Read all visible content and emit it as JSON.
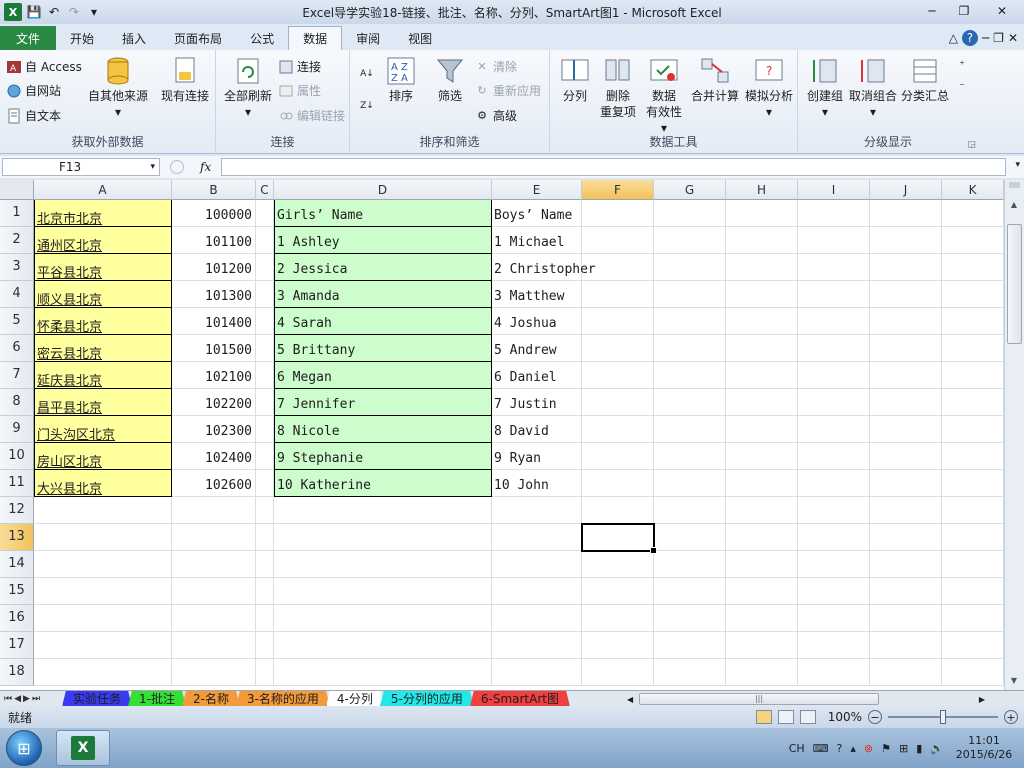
{
  "window": {
    "title": "Excel导学实验18-链接、批注、名称、分列、SmartArt图1 - Microsoft Excel",
    "minimize": "─",
    "maximize": "❐",
    "close": "✕"
  },
  "qat": {
    "save": "💾",
    "undo": "↶",
    "redo": "↷",
    "more": "▾"
  },
  "tabs": [
    "文件",
    "开始",
    "插入",
    "页面布局",
    "公式",
    "数据",
    "审阅",
    "视图"
  ],
  "tab_right": {
    "collapse": "△",
    "help": "?",
    "min": "─",
    "restore": "❐",
    "close": "✕"
  },
  "ribbon": {
    "ext": {
      "label": "获取外部数据",
      "access": "自 Access",
      "web": "自网站",
      "text": "自文本",
      "other": "自其他来源",
      "existing": "现有连接"
    },
    "conn": {
      "label": "连接",
      "refresh": "全部刷新",
      "connections": "连接",
      "properties": "属性",
      "edit_links": "编辑链接"
    },
    "sort": {
      "label": "排序和筛选",
      "az": "A↓Z",
      "za": "Z↓A",
      "sort": "排序",
      "filter": "筛选",
      "clear": "清除",
      "reapply": "重新应用",
      "advanced": "高级"
    },
    "tools": {
      "label": "数据工具",
      "split": "分列",
      "remove_dup_1": "删除",
      "remove_dup_2": "重复项",
      "validation_1": "数据",
      "validation_2": "有效性",
      "consolidate": "合并计算",
      "whatif": "模拟分析"
    },
    "outline": {
      "label": "分级显示",
      "group": "创建组",
      "ungroup": "取消组合",
      "subtotal": "分类汇总"
    }
  },
  "formula_bar": {
    "name_box": "F13",
    "fx": "fx",
    "value": ""
  },
  "columns": [
    "A",
    "B",
    "C",
    "D",
    "E",
    "F",
    "G",
    "H",
    "I",
    "J",
    "K"
  ],
  "selected_column": "F",
  "selected_row": "13",
  "rows": [
    "1",
    "2",
    "3",
    "4",
    "5",
    "6",
    "7",
    "8",
    "9",
    "10",
    "11",
    "12",
    "13",
    "14",
    "15",
    "16",
    "17",
    "18"
  ],
  "cells": {
    "A": [
      "北京市北京",
      "通州区北京",
      "平谷县北京",
      "顺义县北京",
      "怀柔县北京",
      "密云县北京",
      "延庆县北京",
      "昌平县北京",
      "门头沟区北京",
      "房山区北京",
      "大兴县北京"
    ],
    "B": [
      "100000",
      "101100",
      "101200",
      "101300",
      "101400",
      "101500",
      "102100",
      "102200",
      "102300",
      "102400",
      "102600"
    ],
    "D": [
      "Girls’ Name",
      "1 Ashley",
      "2 Jessica",
      "3 Amanda",
      "4 Sarah",
      "5 Brittany",
      "6 Megan",
      "7 Jennifer",
      "8 Nicole",
      "9 Stephanie",
      "10 Katherine"
    ],
    "E": [
      "Boys’ Name",
      "1 Michael",
      "2 Christopher",
      "3 Matthew",
      "4 Joshua",
      "5 Andrew",
      "6 Daniel",
      "7 Justin",
      "8 David",
      "9 Ryan",
      "10 John"
    ]
  },
  "sheet_tabs": [
    {
      "label": "实验任务",
      "color": "#3a3af0"
    },
    {
      "label": "1-批注",
      "color": "#33e033"
    },
    {
      "label": "2-名称",
      "color": "#f39a3a"
    },
    {
      "label": "3-名称的应用",
      "color": "#f39a3a"
    },
    {
      "label": "4-分列",
      "color": "#ffffff"
    },
    {
      "label": "5-分列的应用",
      "color": "#22e8e8"
    },
    {
      "label": "6-SmartArt图",
      "color": "#f04040"
    }
  ],
  "status": {
    "ready": "就绪",
    "zoom": "100%",
    "minus": "−",
    "plus": "+"
  },
  "taskbar": {
    "lang": "CH",
    "time": "11:01",
    "date": "2015/6/26"
  },
  "colors": {
    "yellow_fill": "#ffff9e",
    "green_fill": "#cdfccd",
    "file_tab": "#2a8a43"
  }
}
